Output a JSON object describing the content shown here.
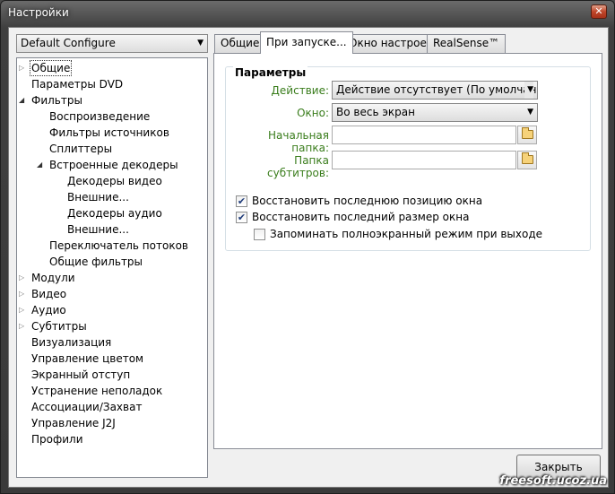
{
  "window": {
    "title": "Настройки",
    "close_glyph": "✕"
  },
  "profile": {
    "selected": "Default Configure"
  },
  "tree": {
    "items": [
      {
        "label": "Общие"
      },
      {
        "label": "Параметры DVD"
      },
      {
        "label": "Фильтры"
      },
      {
        "label": "Воспроизведение"
      },
      {
        "label": "Фильтры источников"
      },
      {
        "label": "Сплиттеры"
      },
      {
        "label": "Встроенные декодеры"
      },
      {
        "label": "Декодеры видео"
      },
      {
        "label": "Внешние..."
      },
      {
        "label": "Декодеры аудио"
      },
      {
        "label": "Внешние..."
      },
      {
        "label": "Переключатель потоков"
      },
      {
        "label": "Общие фильтры"
      },
      {
        "label": "Модули"
      },
      {
        "label": "Видео"
      },
      {
        "label": "Аудио"
      },
      {
        "label": "Субтитры"
      },
      {
        "label": "Визуализация"
      },
      {
        "label": "Управление цветом"
      },
      {
        "label": "Экранный отступ"
      },
      {
        "label": "Устранение неполадок"
      },
      {
        "label": "Ассоциации/Захват"
      },
      {
        "label": "Управление J2J"
      },
      {
        "label": "Профили"
      }
    ]
  },
  "tabs": [
    {
      "label": "Общие"
    },
    {
      "label": "При запуске..."
    },
    {
      "label": "Окно настроек"
    },
    {
      "label": "RealSense™"
    }
  ],
  "params": {
    "group_title": "Параметры",
    "action_label": "Действие:",
    "action_value": "Действие отсутствует (По умолчанию)",
    "window_label": "Окно:",
    "window_value": "Во весь экран",
    "start_folder_label": "Начальная папка:",
    "start_folder_value": "",
    "subtitle_folder_label": "Папка субтитров:",
    "subtitle_folder_value": ""
  },
  "checks": [
    {
      "label": "Восстановить последнюю позицию окна",
      "checked": true
    },
    {
      "label": "Восстановить последний размер окна",
      "checked": true
    },
    {
      "label": "Запоминать полноэкранный режим при выходе",
      "checked": false
    }
  ],
  "footer": {
    "close_label": "Закрыть"
  },
  "watermark": "freesoft.ucoz.ua",
  "icons": {
    "dropdown": "▼",
    "expand": "▷",
    "collapse": "◢",
    "check": "✔"
  },
  "colors": {
    "label_green": "#3a7d1c",
    "titlebar": "#3f3f3f"
  }
}
